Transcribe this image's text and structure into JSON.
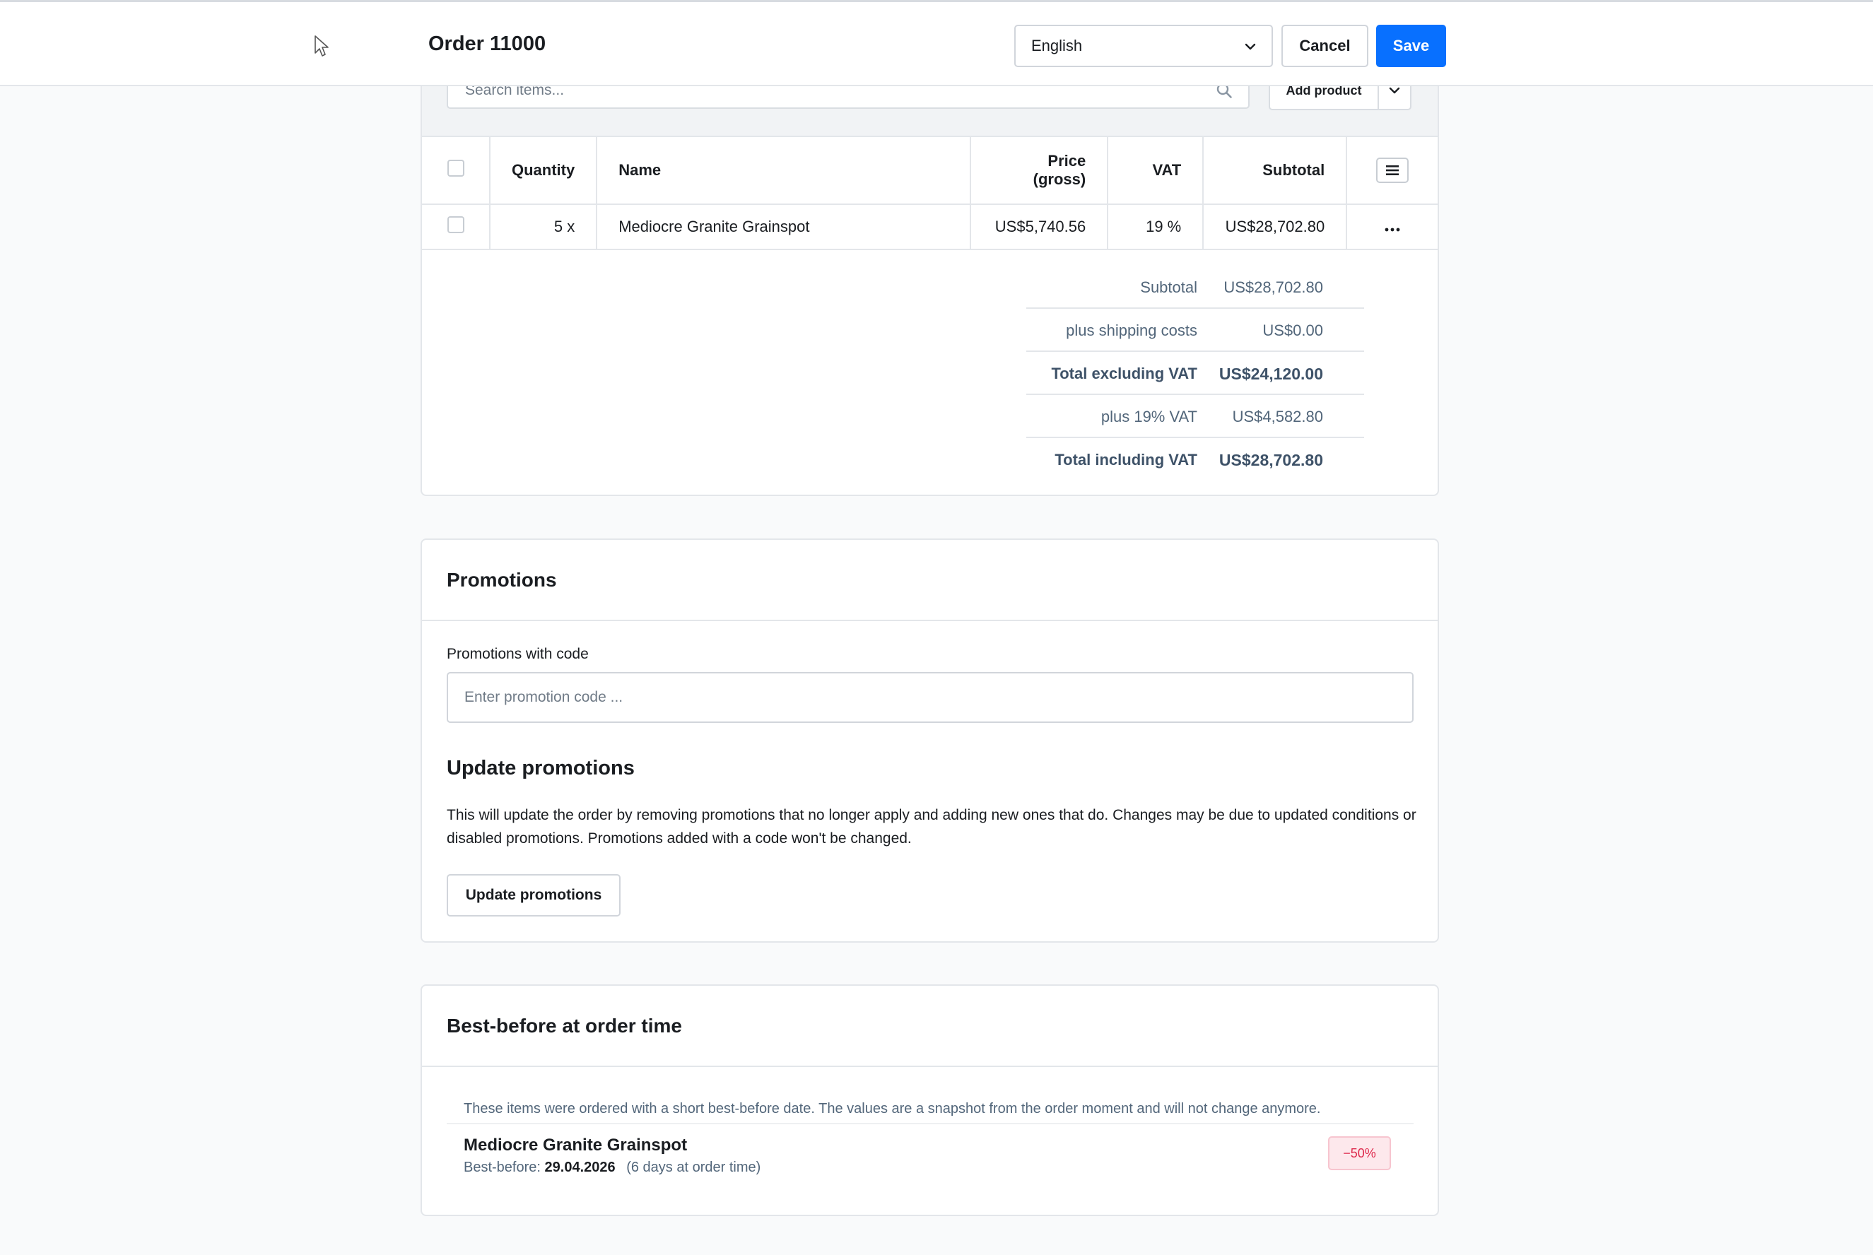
{
  "header": {
    "title": "Order 11000",
    "language": "English",
    "cancel_label": "Cancel",
    "save_label": "Save"
  },
  "items": {
    "search_placeholder": "Search items...",
    "add_product_label": "Add product",
    "columns": {
      "quantity": "Quantity",
      "name": "Name",
      "price": "Price (gross)",
      "vat": "VAT",
      "subtotal": "Subtotal"
    },
    "rows": [
      {
        "quantity": "5 x",
        "name": "Mediocre Granite Grainspot",
        "price": "US$5,740.56",
        "vat": "19 %",
        "subtotal": "US$28,702.80"
      }
    ]
  },
  "summary": [
    {
      "label": "Subtotal",
      "value": "US$28,702.80"
    },
    {
      "label": "plus shipping costs",
      "value": "US$0.00"
    },
    {
      "label": "Total excluding VAT",
      "value": "US$24,120.00"
    },
    {
      "label": "plus 19% VAT",
      "value": "US$4,582.80"
    },
    {
      "label": "Total including VAT",
      "value": "US$28,702.80"
    }
  ],
  "promotions": {
    "title": "Promotions",
    "code_label": "Promotions with code",
    "code_placeholder": "Enter promotion code ...",
    "update_title": "Update promotions",
    "update_description": "This will update the order by removing promotions that no longer apply and adding new ones that do. Changes may be due to updated conditions or disabled promotions. Promotions added with a code won't be changed.",
    "update_button": "Update promotions"
  },
  "best_before": {
    "title": "Best-before at order time",
    "note": "These items were ordered with a short best-before date. The values are a snapshot from the order moment and will not change anymore.",
    "item_name": "Mediocre Granite Grainspot",
    "date_label": "Best-before:",
    "date": "29.04.2026",
    "days_note": "(6 days at order time)",
    "discount_badge": "−50%"
  },
  "colors": {
    "accent": "#0870ff",
    "badge_text": "#de294c",
    "badge_bg": "#fde8ec"
  }
}
